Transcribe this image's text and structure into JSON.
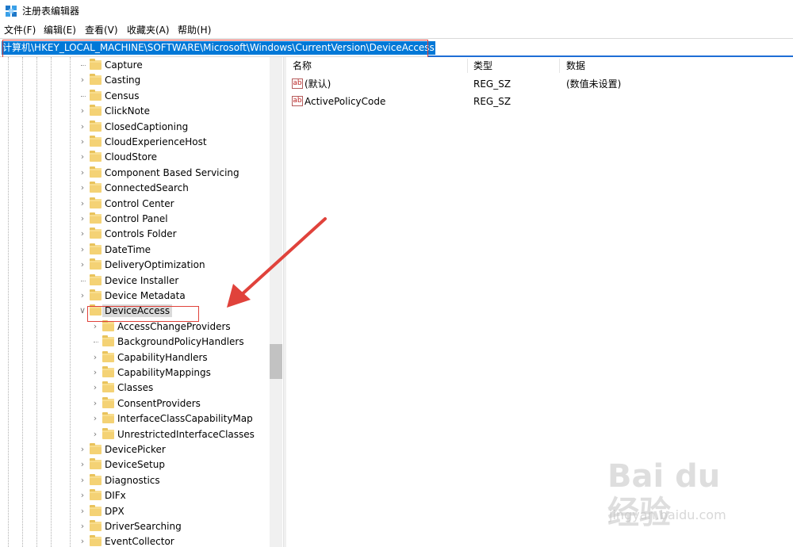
{
  "window": {
    "title": "注册表编辑器"
  },
  "menu": [
    "文件(F)",
    "编辑(E)",
    "查看(V)",
    "收藏夹(A)",
    "帮助(H)"
  ],
  "address": {
    "path": "计算机\\HKEY_LOCAL_MACHINE\\SOFTWARE\\Microsoft\\Windows\\CurrentVersion\\DeviceAccess"
  },
  "tree": {
    "level1": [
      {
        "label": "Capture",
        "expander": "none"
      },
      {
        "label": "Casting",
        "expander": "collapsed"
      },
      {
        "label": "Census",
        "expander": "none"
      },
      {
        "label": "ClickNote",
        "expander": "collapsed"
      },
      {
        "label": "ClosedCaptioning",
        "expander": "collapsed"
      },
      {
        "label": "CloudExperienceHost",
        "expander": "collapsed"
      },
      {
        "label": "CloudStore",
        "expander": "collapsed"
      },
      {
        "label": "Component Based Servicing",
        "expander": "collapsed"
      },
      {
        "label": "ConnectedSearch",
        "expander": "collapsed"
      },
      {
        "label": "Control Center",
        "expander": "collapsed"
      },
      {
        "label": "Control Panel",
        "expander": "collapsed"
      },
      {
        "label": "Controls Folder",
        "expander": "collapsed"
      },
      {
        "label": "DateTime",
        "expander": "collapsed"
      },
      {
        "label": "DeliveryOptimization",
        "expander": "collapsed"
      },
      {
        "label": "Device Installer",
        "expander": "none"
      },
      {
        "label": "Device Metadata",
        "expander": "collapsed"
      },
      {
        "label": "DeviceAccess",
        "expander": "expanded"
      }
    ],
    "children": [
      {
        "label": "AccessChangeProviders",
        "expander": "collapsed"
      },
      {
        "label": "BackgroundPolicyHandlers",
        "expander": "none"
      },
      {
        "label": "CapabilityHandlers",
        "expander": "collapsed"
      },
      {
        "label": "CapabilityMappings",
        "expander": "collapsed"
      },
      {
        "label": "Classes",
        "expander": "collapsed"
      },
      {
        "label": "ConsentProviders",
        "expander": "collapsed"
      },
      {
        "label": "InterfaceClassCapabilityMap",
        "expander": "collapsed"
      },
      {
        "label": "UnrestrictedInterfaceClasses",
        "expander": "collapsed"
      }
    ],
    "after": [
      {
        "label": "DevicePicker",
        "expander": "collapsed"
      },
      {
        "label": "DeviceSetup",
        "expander": "collapsed"
      },
      {
        "label": "Diagnostics",
        "expander": "collapsed"
      },
      {
        "label": "DIFx",
        "expander": "collapsed"
      },
      {
        "label": "DPX",
        "expander": "collapsed"
      },
      {
        "label": "DriverSearching",
        "expander": "collapsed"
      },
      {
        "label": "EventCollector",
        "expander": "collapsed"
      }
    ]
  },
  "values": {
    "headers": {
      "name": "名称",
      "type": "类型",
      "data": "数据"
    },
    "rows": [
      {
        "icon": "ab",
        "name": "(默认)",
        "type": "REG_SZ",
        "data": "(数值未设置)"
      },
      {
        "icon": "ab",
        "name": "ActivePolicyCode",
        "type": "REG_SZ",
        "data": ""
      }
    ]
  },
  "watermark": {
    "brand": "Bai du 经验",
    "sub": "jingyan.baidu.com"
  },
  "colors": {
    "selection": "#0078d7",
    "highlight_box": "#e0423b",
    "folder": "#f4d275"
  }
}
